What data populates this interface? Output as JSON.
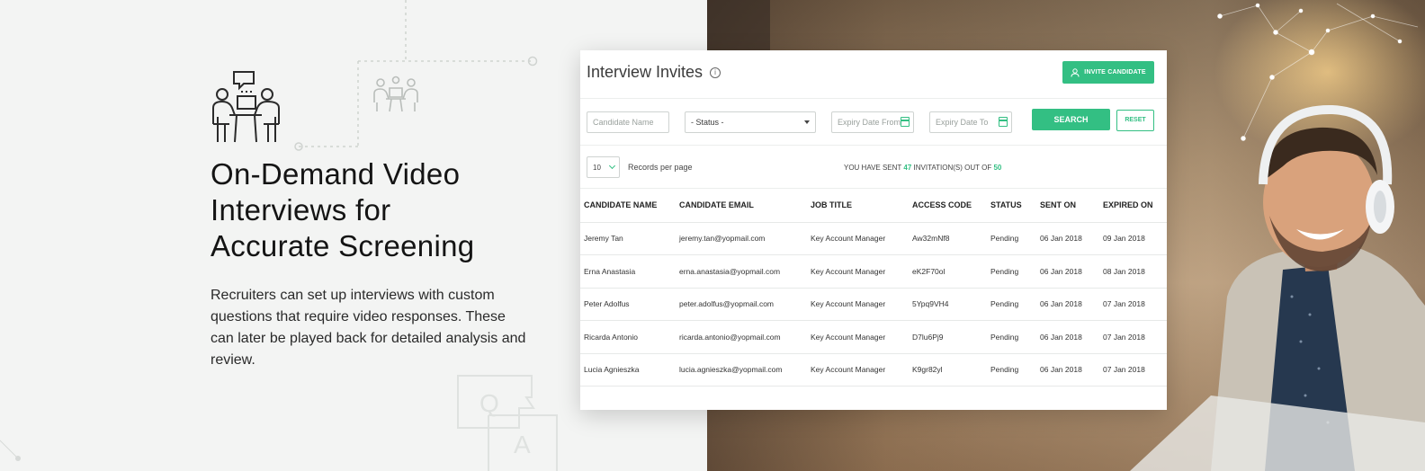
{
  "hero": {
    "title": "On-Demand Video Interviews for Accurate Screening",
    "description": "Recruiters can set up interviews with custom questions that require video responses. These can later be played back for detailed analysis and review."
  },
  "card": {
    "title": "Interview Invites",
    "invite_button": "INVITE CANDIDATE",
    "filters": {
      "candidate_name_placeholder": "Candidate Name",
      "status_value": "- Status -",
      "expiry_from_placeholder": "Expiry Date From",
      "expiry_to_placeholder": "Expiry Date To",
      "search_label": "SEARCH",
      "reset_label": "RESET"
    },
    "records": {
      "per_page_value": "10",
      "per_page_label": "Records per page",
      "sent_prefix": "YOU HAVE SENT",
      "sent_count": "47",
      "sent_middle": "INVITATION(S) OUT OF",
      "sent_total": "50"
    },
    "table": {
      "headers": [
        "CANDIDATE NAME",
        "CANDIDATE EMAIL",
        "JOB TITLE",
        "ACCESS CODE",
        "STATUS",
        "SENT ON",
        "EXPIRED ON"
      ],
      "rows": [
        [
          "Jeremy Tan",
          "jeremy.tan@yopmail.com",
          "Key Account Manager",
          "Aw32mNf8",
          "Pending",
          "06 Jan 2018",
          "09 Jan 2018"
        ],
        [
          "Erna Anastasia",
          "erna.anastasia@yopmail.com",
          "Key Account Manager",
          "eK2F70ol",
          "Pending",
          "06 Jan 2018",
          "08 Jan 2018"
        ],
        [
          "Peter Adolfus",
          "peter.adolfus@yopmail.com",
          "Key Account Manager",
          "5Ypq9VH4",
          "Pending",
          "06 Jan 2018",
          "07 Jan 2018"
        ],
        [
          "Ricarda Antonio",
          "ricarda.antonio@yopmail.com",
          "Key Account Manager",
          "D7lu6Pj9",
          "Pending",
          "06 Jan 2018",
          "07 Jan 2018"
        ],
        [
          "Lucia Agnieszka",
          "lucia.agnieszka@yopmail.com",
          "Key Account Manager",
          "K9gr82yl",
          "Pending",
          "06 Jan 2018",
          "07 Jan 2018"
        ]
      ]
    }
  },
  "deco": {
    "qa_letters": [
      "Q",
      "A"
    ]
  },
  "colors": {
    "accent": "#33bf83",
    "text_dark": "#141414",
    "background": "#f3f4f3"
  }
}
